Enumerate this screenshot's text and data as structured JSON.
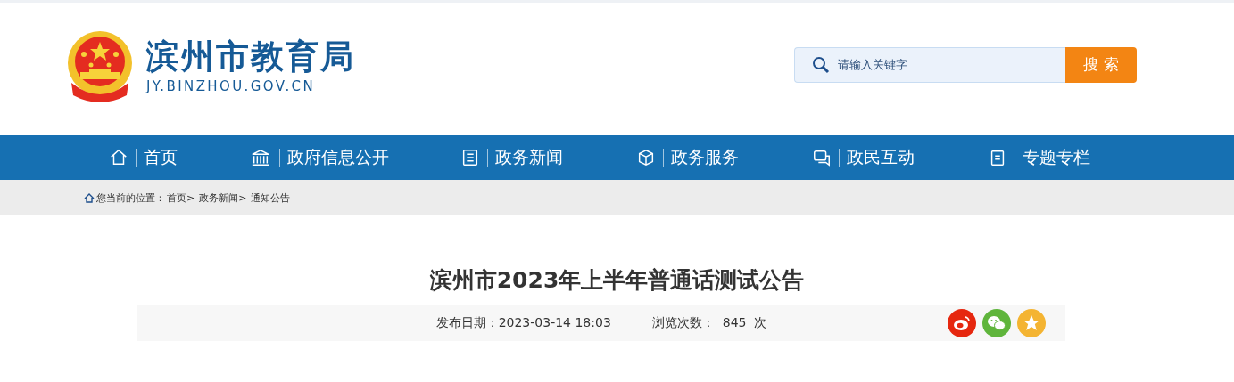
{
  "header": {
    "site_name": "滨州市教育局",
    "domain": "JY.BINZHOU.GOV.CN"
  },
  "search": {
    "placeholder": "请输入关键字",
    "button": "搜 索"
  },
  "nav": [
    {
      "label": "首页",
      "kind": "home"
    },
    {
      "label": "政府信息公开",
      "kind": "building"
    },
    {
      "label": "政务新闻",
      "kind": "document"
    },
    {
      "label": "政务服务",
      "kind": "cube"
    },
    {
      "label": "政民互动",
      "kind": "chat"
    },
    {
      "label": "专题专栏",
      "kind": "clipboard"
    }
  ],
  "breadcrumb": {
    "label": "您当前的位置：",
    "items": [
      "首页>",
      "政务新闻>",
      "通知公告"
    ]
  },
  "article": {
    "title": "滨州市2023年上半年普通话测试公告",
    "date_label": "发布日期：",
    "date": "2023-03-14 18:03",
    "views_label": "浏览次数：",
    "views": "845",
    "views_unit": "次"
  },
  "share": [
    {
      "kind": "weibo",
      "color": "#e6270f"
    },
    {
      "kind": "wechat",
      "color": "#5fb53c"
    },
    {
      "kind": "qzone",
      "color": "#f4b432"
    }
  ]
}
